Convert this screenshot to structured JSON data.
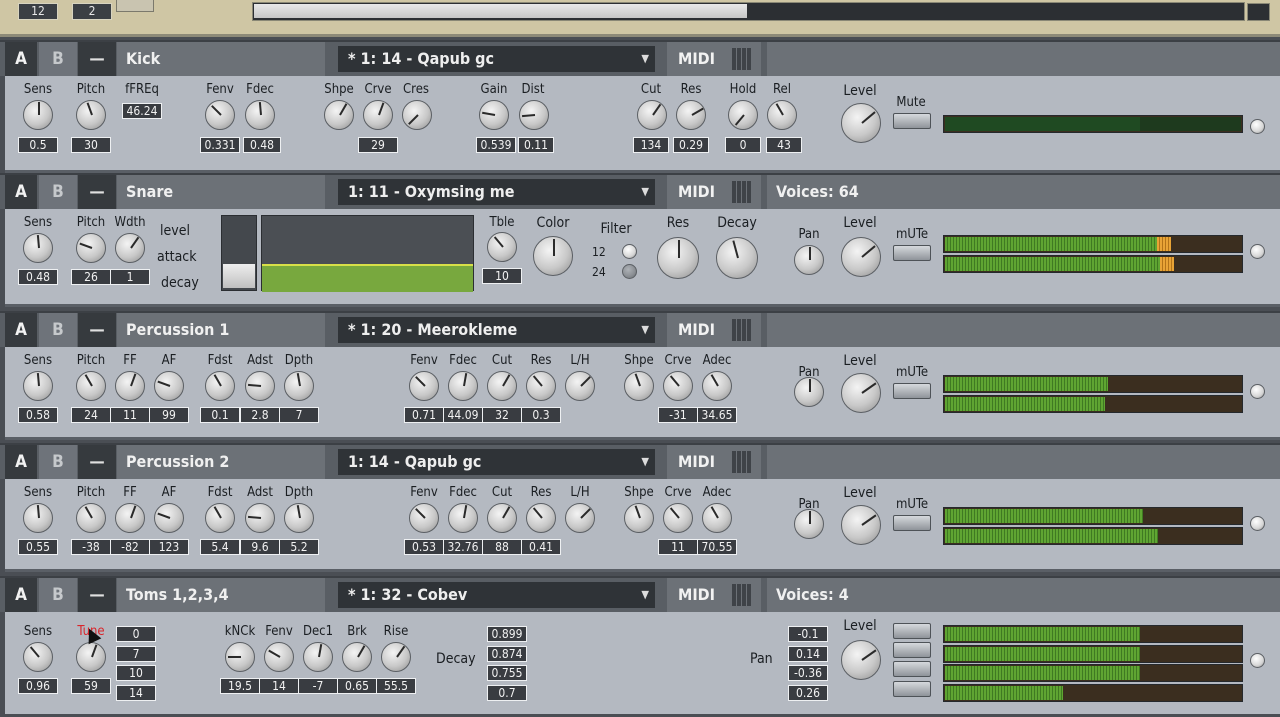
{
  "topbar": {
    "num1": "12",
    "num2": "2"
  },
  "common": {
    "a": "A",
    "b": "B",
    "minus": "—",
    "midi": "MIDI"
  },
  "kick": {
    "name": "Kick",
    "patch": "* 1: 14 - Qapub gc",
    "labels": {
      "sens": "Sens",
      "pitch": "Pitch",
      "ffreq": "fFREq",
      "fenv": "Fenv",
      "fdec": "Fdec",
      "shpe": "Shpe",
      "crve": "Crve",
      "cres": "Cres",
      "gain": "Gain",
      "dist": "Dist",
      "cut": "Cut",
      "res": "Res",
      "hold": "Hold",
      "rel": "Rel",
      "level": "Level",
      "mute": "Mute"
    },
    "values": {
      "sens": "0.5",
      "pitch": "30",
      "ffreq": "46.24",
      "fenv": "0.331",
      "fdec": "0.48",
      "crve": "29",
      "gain": "0.539",
      "dist": "0.11",
      "cut": "134",
      "res": "0.29",
      "hold": "0",
      "rel": "43"
    },
    "meter_level": 0.66
  },
  "snare": {
    "name": "Snare",
    "patch": "1: 11 - Oxymsing me",
    "voices": "Voices: 64",
    "labels": {
      "sens": "Sens",
      "pitch": "Pitch",
      "wdth": "Wdth",
      "level": "level",
      "attack": "attack",
      "decay": "decay",
      "tble": "Tble",
      "color": "Color",
      "filter": "Filter",
      "f12": "12",
      "f24": "24",
      "res": "Res",
      "decay2": "Decay",
      "pan": "Pan",
      "level2": "Level",
      "mute": "mUTe"
    },
    "values": {
      "sens": "0.48",
      "pitch": "26",
      "wdth": "1",
      "tble": "10"
    },
    "meter_levels": [
      0.72,
      0.73
    ]
  },
  "perc1": {
    "name": "Percussion 1",
    "patch": "* 1: 20 - Meerokleme",
    "labels": {
      "sens": "Sens",
      "pitch": "Pitch",
      "ff": "FF",
      "af": "AF",
      "fdst": "Fdst",
      "adst": "Adst",
      "dpth": "Dpth",
      "fenv": "Fenv",
      "fdec": "Fdec",
      "cut": "Cut",
      "res": "Res",
      "lh": "L/H",
      "shpe": "Shpe",
      "crve": "Crve",
      "adec": "Adec",
      "pan": "Pan",
      "level": "Level",
      "mute": "mUTe"
    },
    "values": {
      "sens": "0.58",
      "pitch": "24",
      "ff": "11",
      "af": "99",
      "fdst": "0.1",
      "adst": "2.8",
      "dpth": "7",
      "fenv": "0.71",
      "fdec": "44.09",
      "cut": "32",
      "res": "0.3",
      "crve": "-31",
      "adec": "34.65"
    },
    "meter_levels": [
      0.55,
      0.54
    ]
  },
  "perc2": {
    "name": "Percussion 2",
    "patch": "1: 14 - Qapub gc",
    "labels": {
      "sens": "Sens",
      "pitch": "Pitch",
      "ff": "FF",
      "af": "AF",
      "fdst": "Fdst",
      "adst": "Adst",
      "dpth": "Dpth",
      "fenv": "Fenv",
      "fdec": "Fdec",
      "cut": "Cut",
      "res": "Res",
      "lh": "L/H",
      "shpe": "Shpe",
      "crve": "Crve",
      "adec": "Adec",
      "pan": "Pan",
      "level": "Level",
      "mute": "mUTe"
    },
    "values": {
      "sens": "0.55",
      "pitch": "-38",
      "ff": "-82",
      "af": "123",
      "fdst": "5.4",
      "adst": "9.6",
      "dpth": "5.2",
      "fenv": "0.53",
      "fdec": "32.76",
      "cut": "88",
      "res": "0.41",
      "crve": "11",
      "adec": "70.55"
    },
    "meter_levels": [
      0.67,
      0.72
    ]
  },
  "toms": {
    "name": "Toms 1,2,3,4",
    "patch": "* 1: 32 - Cobev",
    "voices": "Voices: 4",
    "labels": {
      "sens": "Sens",
      "tune": "Tune",
      "knck": "kNCk",
      "fenv": "Fenv",
      "dec1": "Dec1",
      "brk": "Brk",
      "rise": "Rise",
      "decay": "Decay",
      "pan": "Pan",
      "level": "Level"
    },
    "values": {
      "sens": "0.96",
      "tune": "59",
      "tunes": [
        "0",
        "7",
        "10",
        "14"
      ],
      "knck": "19.5",
      "fenv": "14",
      "dec1": "-7",
      "brk": "0.65",
      "rise": "55.5",
      "decays": [
        "0.899",
        "0.874",
        "0.755",
        "0.7"
      ],
      "pans": [
        "-0.1",
        "0.14",
        "-0.36",
        "0.26"
      ]
    },
    "meter_levels": [
      0.66,
      0.66,
      0.66,
      0.4
    ]
  }
}
